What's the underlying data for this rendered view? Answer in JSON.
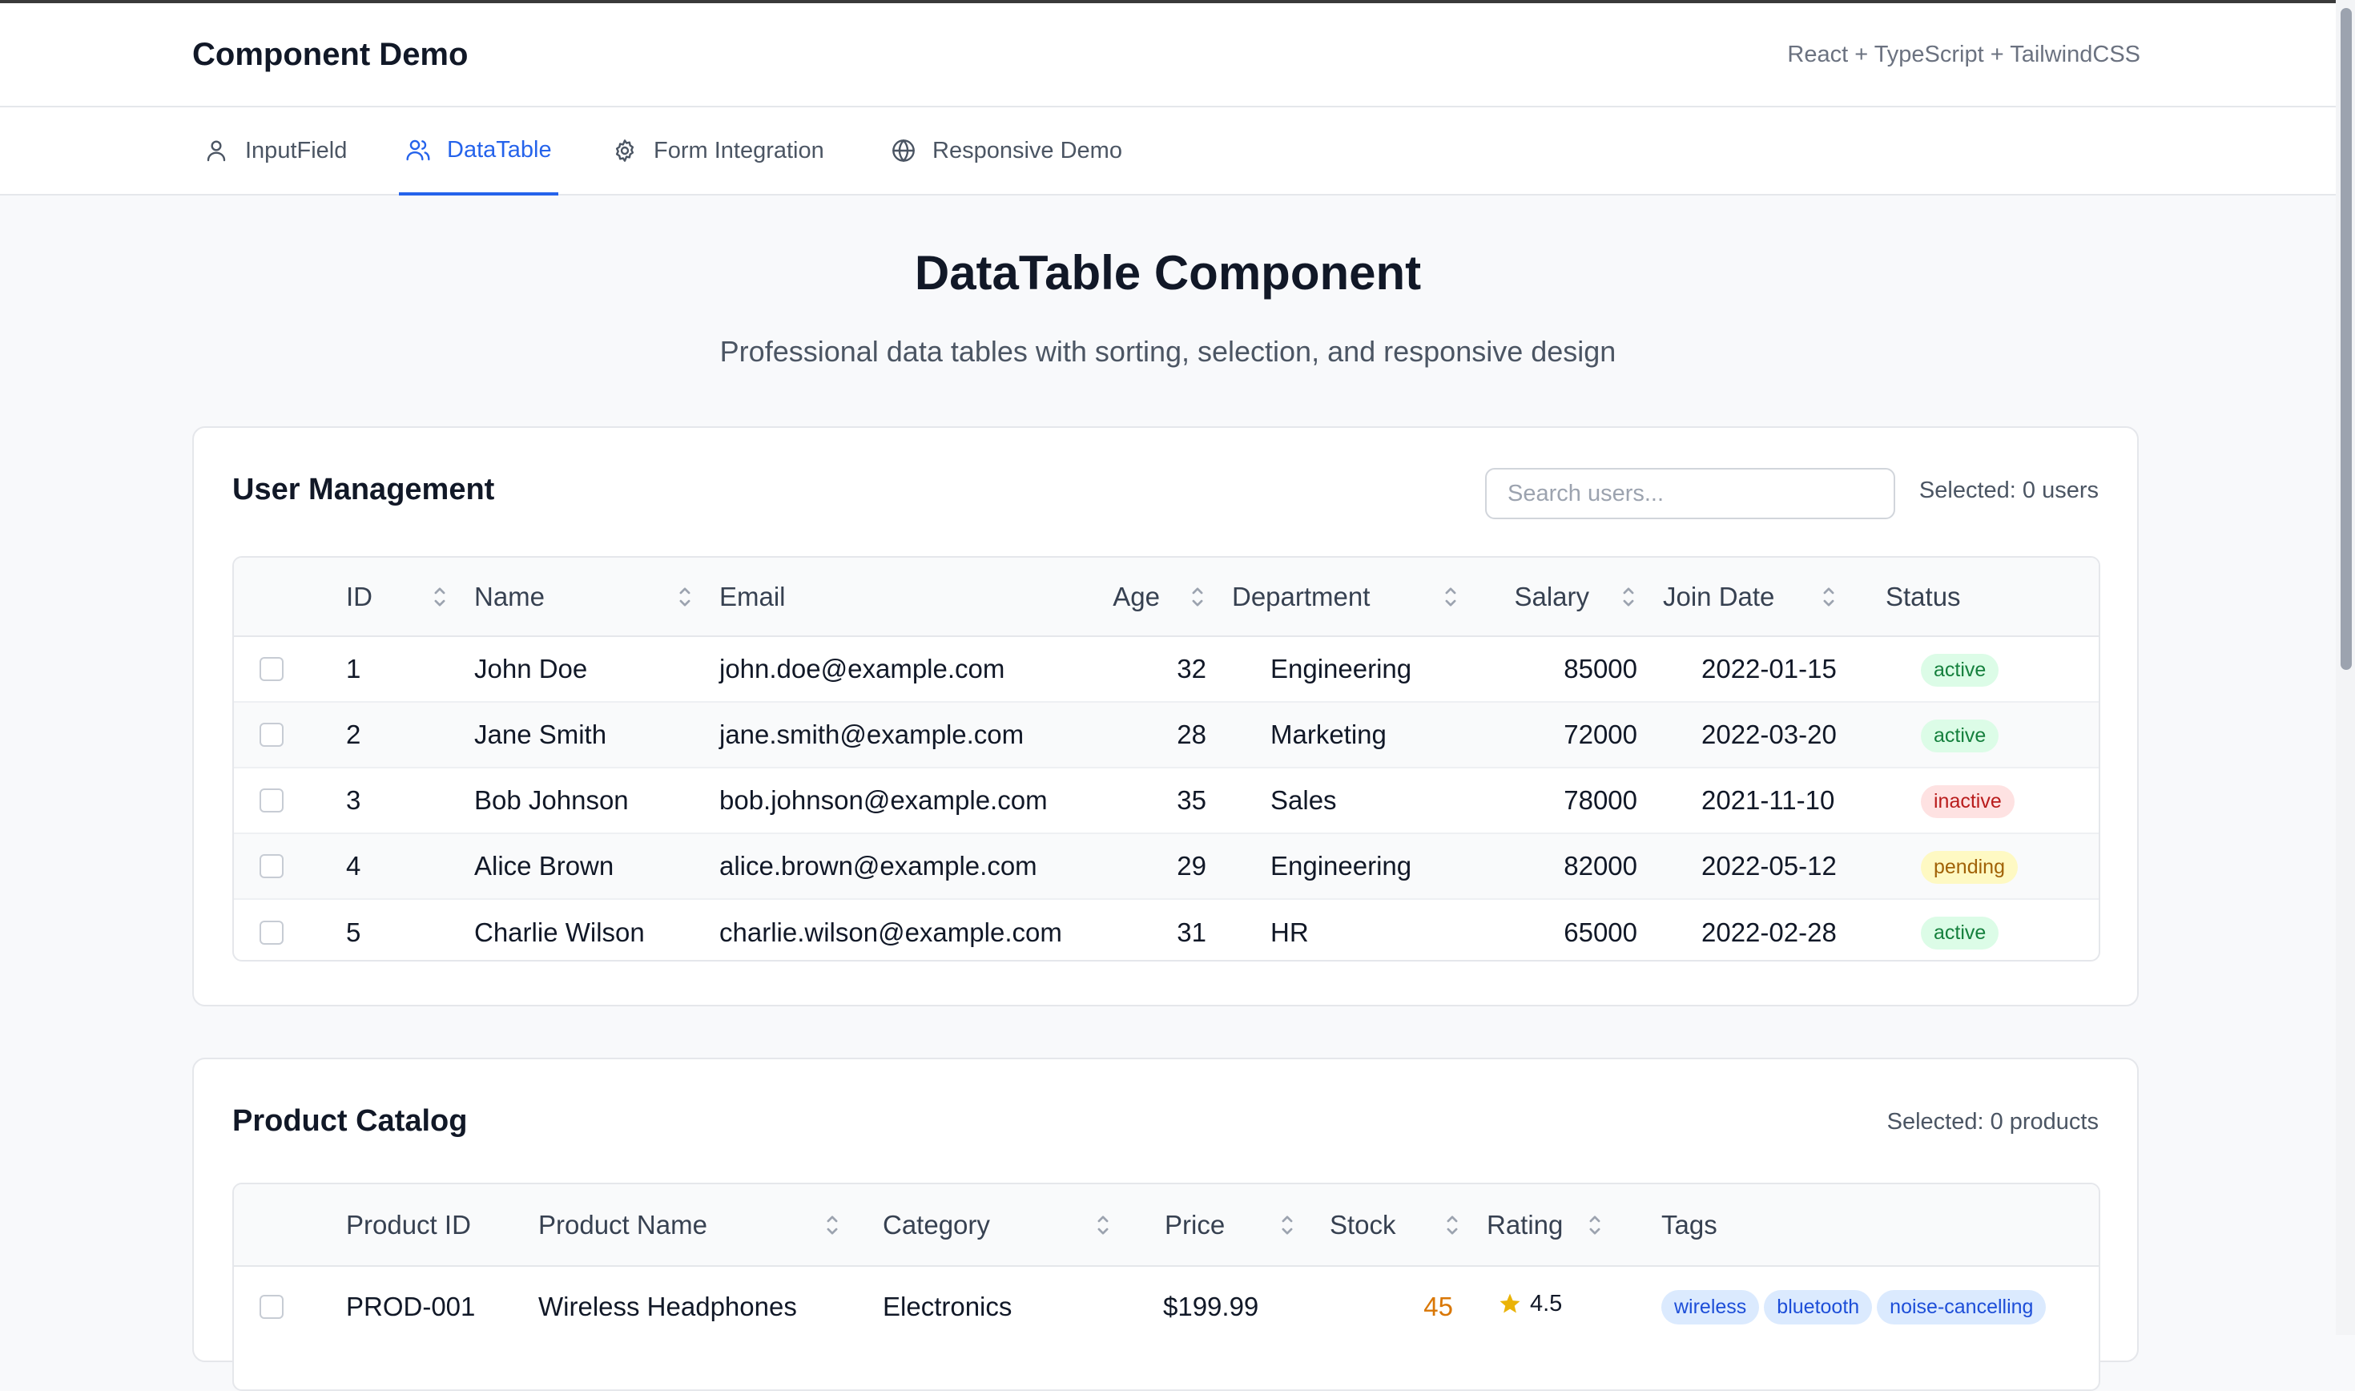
{
  "header": {
    "title": "Component Demo",
    "tech": "React + TypeScript + TailwindCSS"
  },
  "tabs": [
    {
      "label": "InputField",
      "icon": "user-icon",
      "active": false
    },
    {
      "label": "DataTable",
      "icon": "users-icon",
      "active": true
    },
    {
      "label": "Form Integration",
      "icon": "gear-icon",
      "active": false
    },
    {
      "label": "Responsive Demo",
      "icon": "globe-icon",
      "active": false
    }
  ],
  "page": {
    "title": "DataTable Component",
    "subtitle": "Professional data tables with sorting, selection, and responsive design"
  },
  "users": {
    "title": "User Management",
    "search_placeholder": "Search users...",
    "search_value": "",
    "selected": "Selected: 0 users",
    "columns": [
      "ID",
      "Name",
      "Email",
      "Age",
      "Department",
      "Salary",
      "Join Date",
      "Status"
    ],
    "rows": [
      {
        "id": "1",
        "name": "John Doe",
        "email": "john.doe@example.com",
        "age": "32",
        "department": "Engineering",
        "salary": "85000",
        "join": "2022-01-15",
        "status": "active"
      },
      {
        "id": "2",
        "name": "Jane Smith",
        "email": "jane.smith@example.com",
        "age": "28",
        "department": "Marketing",
        "salary": "72000",
        "join": "2022-03-20",
        "status": "active"
      },
      {
        "id": "3",
        "name": "Bob Johnson",
        "email": "bob.johnson@example.com",
        "age": "35",
        "department": "Sales",
        "salary": "78000",
        "join": "2021-11-10",
        "status": "inactive"
      },
      {
        "id": "4",
        "name": "Alice Brown",
        "email": "alice.brown@example.com",
        "age": "29",
        "department": "Engineering",
        "salary": "82000",
        "join": "2022-05-12",
        "status": "pending"
      },
      {
        "id": "5",
        "name": "Charlie Wilson",
        "email": "charlie.wilson@example.com",
        "age": "31",
        "department": "HR",
        "salary": "65000",
        "join": "2022-02-28",
        "status": "active"
      }
    ]
  },
  "products": {
    "title": "Product Catalog",
    "selected": "Selected: 0 products",
    "columns": [
      "Product ID",
      "Product Name",
      "Category",
      "Price",
      "Stock",
      "Rating",
      "Tags"
    ],
    "rows": [
      {
        "id": "PROD-001",
        "name": "Wireless Headphones",
        "category": "Electronics",
        "price": "$199.99",
        "stock": "45",
        "rating": "4.5",
        "rating_value": 4.5,
        "tags": [
          "wireless",
          "bluetooth",
          "noise-cancelling"
        ]
      }
    ]
  },
  "colors": {
    "accent": "#2563eb",
    "status_active": "#15803d",
    "status_inactive": "#b91c1c",
    "status_pending": "#a16207",
    "star": "#eab308",
    "stock": "#d97706"
  }
}
